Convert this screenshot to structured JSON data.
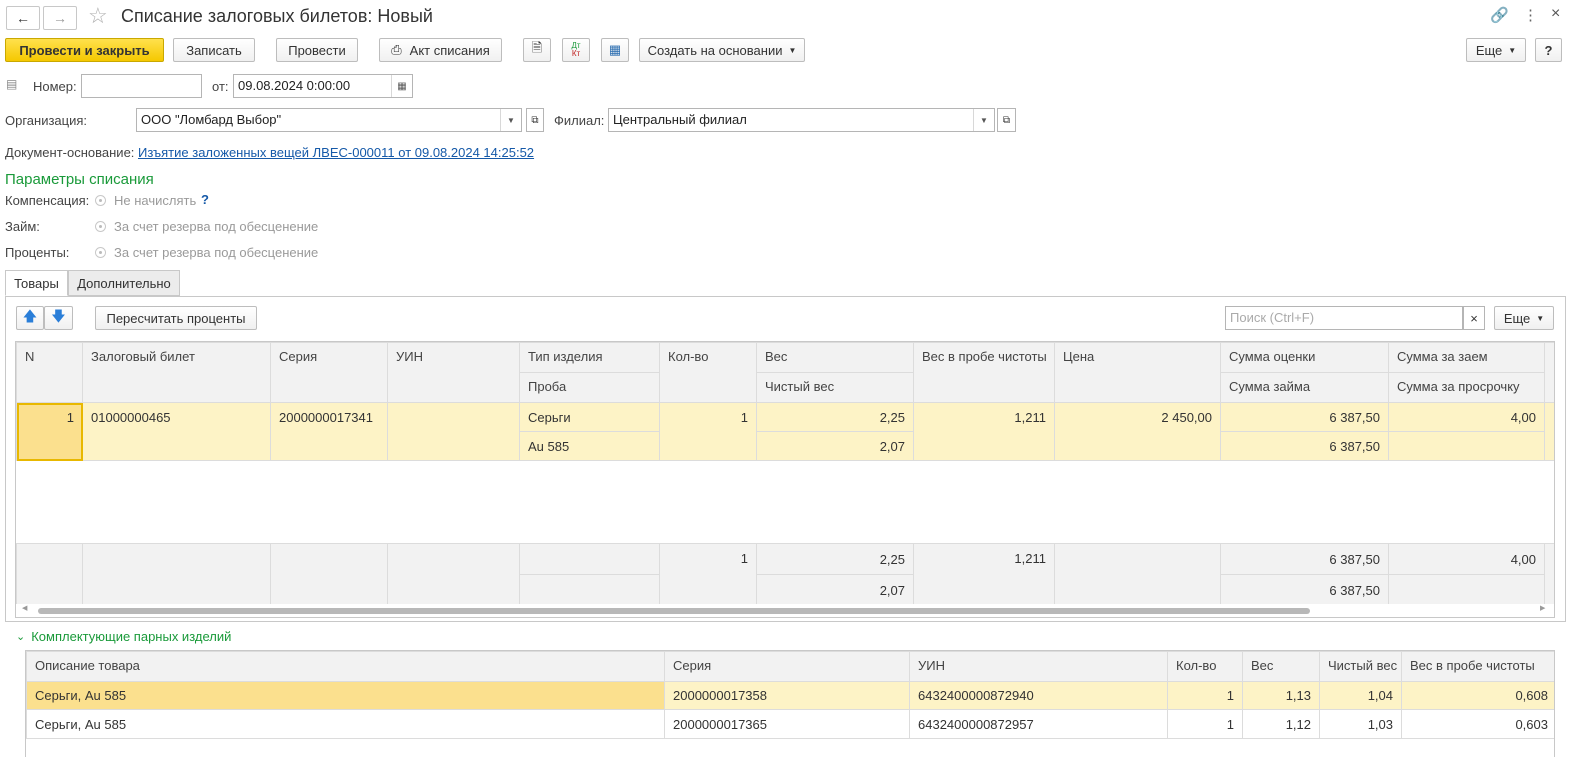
{
  "window": {
    "title": "Списание залоговых билетов: Новый"
  },
  "toolbar": {
    "post_close": "Провести и закрыть",
    "save": "Записать",
    "post": "Провести",
    "act": "Акт списания",
    "dtkt_top": "Дт",
    "dtkt_bottom": "Кт",
    "create_based": "Создать на основании",
    "more": "Еще",
    "help": "?"
  },
  "header": {
    "number_label": "Номер:",
    "number_value": "",
    "date_label": "от:",
    "date_value": "09.08.2024  0:00:00",
    "org_label": "Организация:",
    "org_value": "ООО \"Ломбард Выбор\"",
    "branch_label": "Филиал:",
    "branch_value": "Центральный филиал",
    "basis_label": "Документ-основание:",
    "basis_link": "Изъятие заложенных вещей ЛВЕС-000011 от 09.08.2024 14:25:52"
  },
  "params": {
    "section_title": "Параметры списания",
    "compensation_label": "Компенсация:",
    "compensation_value": "Не начислять",
    "compensation_help": "?",
    "loan_label": "Займ:",
    "loan_value": "За счет резерва под обесценение",
    "percent_label": "Проценты:",
    "percent_value": "За счет резерва под обесценение"
  },
  "tabs": {
    "goods": "Товары",
    "extra": "Дополнительно"
  },
  "goods_toolbar": {
    "recalc": "Пересчитать проценты",
    "search_placeholder": "Поиск (Ctrl+F)",
    "clear": "×",
    "more": "Еще"
  },
  "goods_table": {
    "headers": {
      "n": "N",
      "ticket": "Залоговый билет",
      "series": "Серия",
      "uin": "УИН",
      "type": "Тип изделия",
      "probe": "Проба",
      "qty": "Кол-во",
      "weight": "Вес",
      "net_weight": "Чистый вес",
      "pure_weight": "Вес в пробе чистоты",
      "price": "Цена",
      "appraisal": "Сумма оценки",
      "loan_sum": "Сумма займа",
      "sum_loan": "Сумма за заем",
      "sum_overdue": "Сумма за просрочку"
    },
    "row": {
      "n": "1",
      "ticket": "01000000465",
      "series": "2000000017341",
      "uin": "",
      "type": "Серьги",
      "probe": "Au 585",
      "qty": "1",
      "weight": "2,25",
      "net_weight": "2,07",
      "pure_weight": "1,211",
      "price": "2 450,00",
      "appraisal": "6 387,50",
      "loan_sum": "6 387,50",
      "sum_loan": "4,00",
      "sum_overdue": ""
    },
    "totals": {
      "qty": "1",
      "weight": "2,25",
      "net_weight": "2,07",
      "pure_weight": "1,211",
      "appraisal": "6 387,50",
      "loan_sum": "6 387,50",
      "sum_loan": "4,00"
    }
  },
  "components": {
    "title": "Комплектующие парных изделий",
    "headers": {
      "desc": "Описание товара",
      "series": "Серия",
      "uin": "УИН",
      "qty": "Кол-во",
      "weight": "Вес",
      "net": "Чистый вес",
      "pure": "Вес в пробе чистоты"
    },
    "rows": [
      {
        "desc": "Серьги, Au 585",
        "series": "2000000017358",
        "uin": "6432400000872940",
        "qty": "1",
        "weight": "1,13",
        "net": "1,04",
        "pure": "0,608"
      },
      {
        "desc": "Серьги, Au 585",
        "series": "2000000017365",
        "uin": "6432400000872957",
        "qty": "1",
        "weight": "1,12",
        "net": "1,03",
        "pure": "0,603"
      }
    ]
  },
  "colors": {
    "accent_yellow": "#f5c800",
    "section_green": "#1a9a3a",
    "link_blue": "#1559a8",
    "selected_row": "#fdf3c6"
  }
}
